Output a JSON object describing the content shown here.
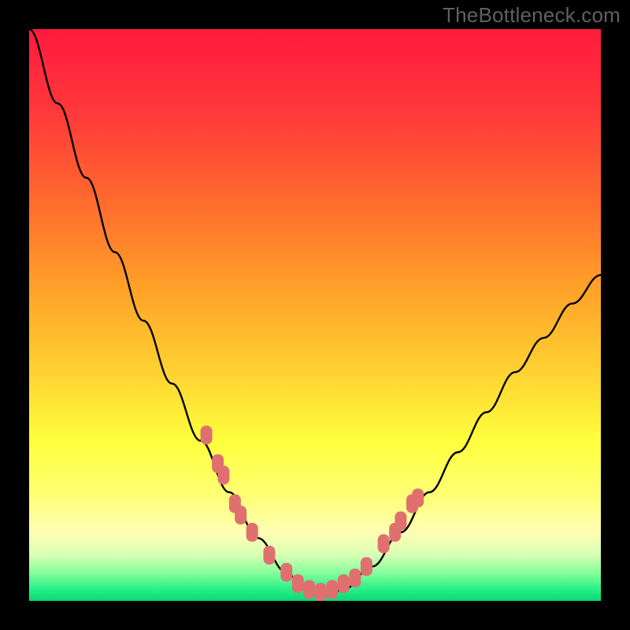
{
  "attribution": "TheBottleneck.com",
  "chart_data": {
    "type": "line",
    "title": "",
    "xlabel": "",
    "ylabel": "",
    "xlim": [
      0,
      100
    ],
    "ylim": [
      0,
      100
    ],
    "series": [
      {
        "name": "bottleneck-curve",
        "x": [
          0,
          5,
          10,
          15,
          20,
          25,
          30,
          35,
          40,
          45,
          48,
          50,
          52,
          55,
          60,
          65,
          70,
          75,
          80,
          85,
          90,
          95,
          100
        ],
        "y": [
          100,
          87,
          74,
          61,
          49,
          38,
          28,
          19,
          11,
          5,
          2,
          1,
          1,
          2,
          6,
          12,
          19,
          26,
          33,
          40,
          46,
          52,
          57
        ]
      }
    ],
    "sample_markers": {
      "name": "sample-points",
      "points": [
        {
          "x": 31,
          "y": 29
        },
        {
          "x": 33,
          "y": 24
        },
        {
          "x": 34,
          "y": 22
        },
        {
          "x": 36,
          "y": 17
        },
        {
          "x": 37,
          "y": 15
        },
        {
          "x": 39,
          "y": 12
        },
        {
          "x": 42,
          "y": 8
        },
        {
          "x": 45,
          "y": 5
        },
        {
          "x": 47,
          "y": 3
        },
        {
          "x": 49,
          "y": 2
        },
        {
          "x": 51,
          "y": 1.5
        },
        {
          "x": 53,
          "y": 2
        },
        {
          "x": 55,
          "y": 3
        },
        {
          "x": 57,
          "y": 4
        },
        {
          "x": 59,
          "y": 6
        },
        {
          "x": 62,
          "y": 10
        },
        {
          "x": 64,
          "y": 12
        },
        {
          "x": 65,
          "y": 14
        },
        {
          "x": 67,
          "y": 17
        },
        {
          "x": 68,
          "y": 18
        }
      ]
    },
    "gradient_stops": [
      {
        "pct": 0,
        "color": "#ff1a3d"
      },
      {
        "pct": 15,
        "color": "#ff3a3a"
      },
      {
        "pct": 30,
        "color": "#ff6a2e"
      },
      {
        "pct": 45,
        "color": "#ffa028"
      },
      {
        "pct": 60,
        "color": "#ffd232"
      },
      {
        "pct": 72,
        "color": "#ffff3c"
      },
      {
        "pct": 82,
        "color": "#ffff78"
      },
      {
        "pct": 88,
        "color": "#ffffb4"
      },
      {
        "pct": 92,
        "color": "#d8ffb4"
      },
      {
        "pct": 95,
        "color": "#88ff9c"
      },
      {
        "pct": 98,
        "color": "#28f088"
      },
      {
        "pct": 100,
        "color": "#08d870"
      }
    ],
    "marker_color": "#e07070",
    "curve_color": "#000000"
  }
}
